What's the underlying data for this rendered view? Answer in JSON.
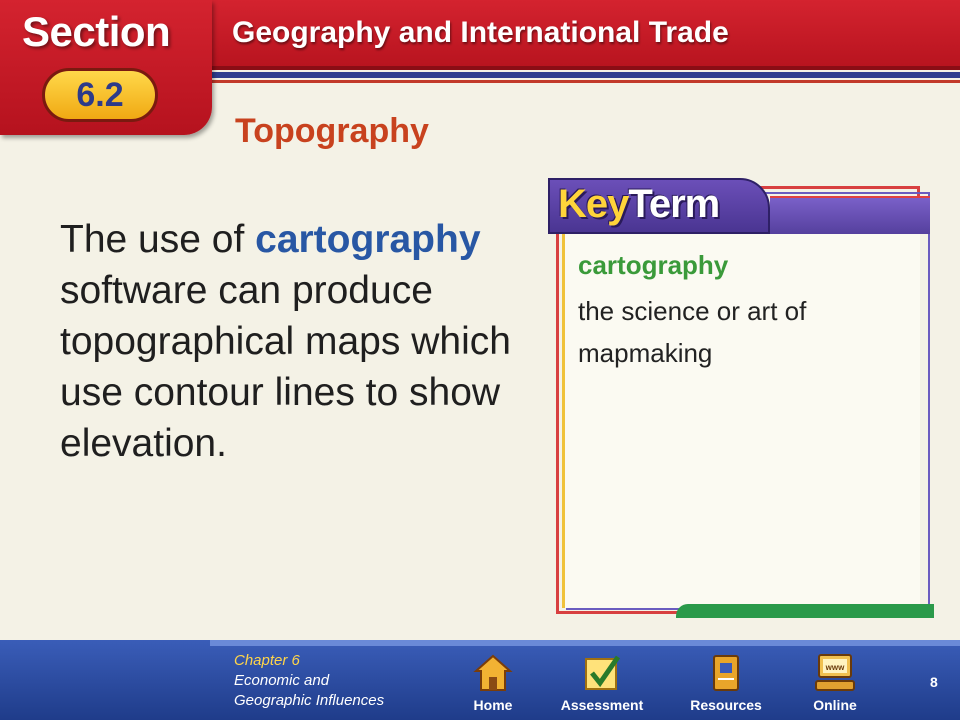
{
  "header": {
    "section_word": "Section",
    "section_number": "6.2",
    "title": "Geography and International Trade",
    "topic": "Topography"
  },
  "main": {
    "text_before": "The use of ",
    "highlight": "cartography",
    "text_after": " software can produce topographical maps which use contour lines to show elevation."
  },
  "key_term": {
    "banner_key": "Key",
    "banner_term": "Term",
    "term": "cartography",
    "definition": "the science or art of mapmaking"
  },
  "footer": {
    "chapter": "Chapter 6",
    "chapter_subtitle_1": "Economic and",
    "chapter_subtitle_2": "Geographic Influences",
    "nav": [
      {
        "label": "Home",
        "icon": "home-icon"
      },
      {
        "label": "Assessment",
        "icon": "checkmark-icon"
      },
      {
        "label": "Resources",
        "icon": "book-icon"
      },
      {
        "label": "Online",
        "icon": "computer-icon"
      }
    ],
    "page_number": "8"
  },
  "colors": {
    "header_red": "#c81c28",
    "footer_blue": "#2a4aa0",
    "topic_orange": "#c8421e",
    "highlight_blue": "#2857a4",
    "term_green": "#3a9a3a",
    "badge_gold": "#f5bf2a"
  }
}
